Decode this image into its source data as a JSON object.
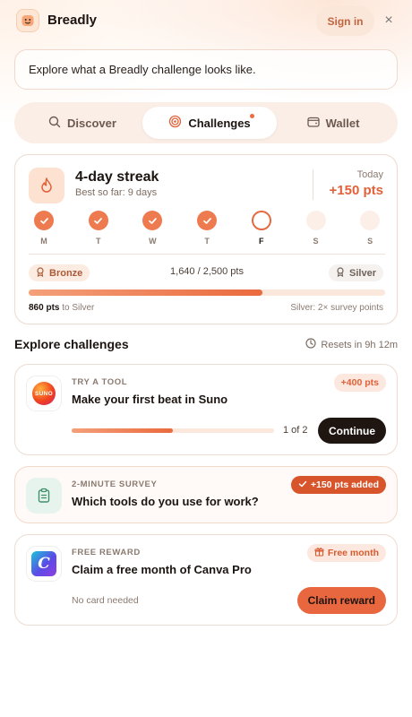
{
  "header": {
    "brand": "Breadly",
    "sign_in": "Sign in",
    "close_icon": "×"
  },
  "banner": {
    "text": "Explore what a Breadly challenge looks like."
  },
  "tabs": [
    {
      "label": "Discover",
      "icon": "search-icon",
      "active": false
    },
    {
      "label": "Challenges",
      "icon": "target-icon",
      "active": true,
      "has_dot": true
    },
    {
      "label": "Wallet",
      "icon": "wallet-icon",
      "active": false
    }
  ],
  "streak": {
    "title": "4-day streak",
    "best": "Best so far: 9 days",
    "today_label": "Today",
    "today_pts": "+150 pts",
    "days": [
      {
        "label": "M",
        "state": "done"
      },
      {
        "label": "T",
        "state": "done"
      },
      {
        "label": "W",
        "state": "done"
      },
      {
        "label": "T",
        "state": "done"
      },
      {
        "label": "F",
        "state": "current"
      },
      {
        "label": "S",
        "state": "future"
      },
      {
        "label": "S",
        "state": "future"
      }
    ],
    "tier_current": "Bronze",
    "tier_next": "Silver",
    "points_progress": "1,640 / 2,500 pts",
    "progress_fraction": 0.656,
    "to_next_pts": "860 pts",
    "to_next_text": "to Silver",
    "next_tier_perk": "Silver: 2× survey points"
  },
  "challenges": {
    "title": "Explore challenges",
    "resets": "Resets in 9h 12m",
    "items": [
      {
        "kicker": "TRY A TOOL",
        "title": "Make your first beat in Suno",
        "badge": "+400 pts",
        "progress_text": "1 of 2",
        "progress_fraction": 0.5,
        "action": "Continue",
        "logo_text": "SUNO"
      },
      {
        "kicker": "2-MINUTE SURVEY",
        "title": "Which tools do you use for work?",
        "badge": "+150 pts added"
      },
      {
        "kicker": "FREE REWARD",
        "title": "Claim a free month of Canva Pro",
        "badge": "Free month",
        "note": "No card needed",
        "action": "Claim reward",
        "logo_text": "C"
      }
    ]
  },
  "colors": {
    "accent": "#e8673f",
    "accent_light": "#fce8de",
    "dark": "#1f1511"
  }
}
